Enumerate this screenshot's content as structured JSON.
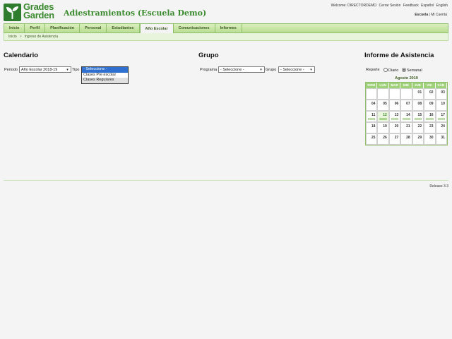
{
  "header": {
    "logo_line1": "Grades",
    "logo_line2": "Garden",
    "app_title": "Adiestramientos (Escuela Demo)",
    "welcome": "Welcome: DIRECTORDEMO",
    "links": [
      "Cerrar Sesión",
      "Feedback",
      "Español",
      "English"
    ],
    "escuela": "Escuela",
    "mi_cuenta": "Mi Cuenta"
  },
  "nav": {
    "items": [
      "Inicio",
      "Perfil",
      "Planificación",
      "Personal",
      "Estudiantes",
      "Año Escolar",
      "Comunicaciones",
      "Informes"
    ],
    "active": "Año Escolar"
  },
  "breadcrumb": {
    "home": "Inicio",
    "sep": ">",
    "current": "Ingreso de Asistencia"
  },
  "calendario": {
    "title": "Calendario",
    "periodo_label": "Periodo",
    "periodo_value": "Año Escolar 2018-19",
    "tipo_label": "Tipo",
    "tipo_options": [
      "- Seleccione -",
      "Clases Pre escolar",
      "Clases Regulares"
    ]
  },
  "grupo": {
    "title": "Grupo",
    "programa_label": "Programa",
    "programa_value": "- Seleccione -",
    "grupo_label": "Grupo",
    "grupo_value": "- Seleccione -"
  },
  "informe": {
    "title": "Informe de Asistencia",
    "reporte_label": "Reporte",
    "diario": "Diario",
    "semanal": "Semanal",
    "selected": "Semanal",
    "month": "Agosto 2019",
    "weekdays": [
      "DOM",
      "LUN",
      "MAR",
      "MIE",
      "JUE",
      "VIE",
      "SÁB"
    ],
    "weeks": [
      [
        "",
        "",
        "",
        "",
        "01",
        "02",
        "03"
      ],
      [
        "04",
        "05",
        "06",
        "07",
        "08",
        "09",
        "10"
      ],
      [
        "11",
        "12",
        "13",
        "14",
        "15",
        "16",
        "17"
      ],
      [
        "18",
        "19",
        "20",
        "21",
        "22",
        "23",
        "24"
      ],
      [
        "25",
        "26",
        "27",
        "28",
        "29",
        "30",
        "31"
      ]
    ],
    "today": "12"
  },
  "footer": {
    "release": "Release 3.3"
  }
}
